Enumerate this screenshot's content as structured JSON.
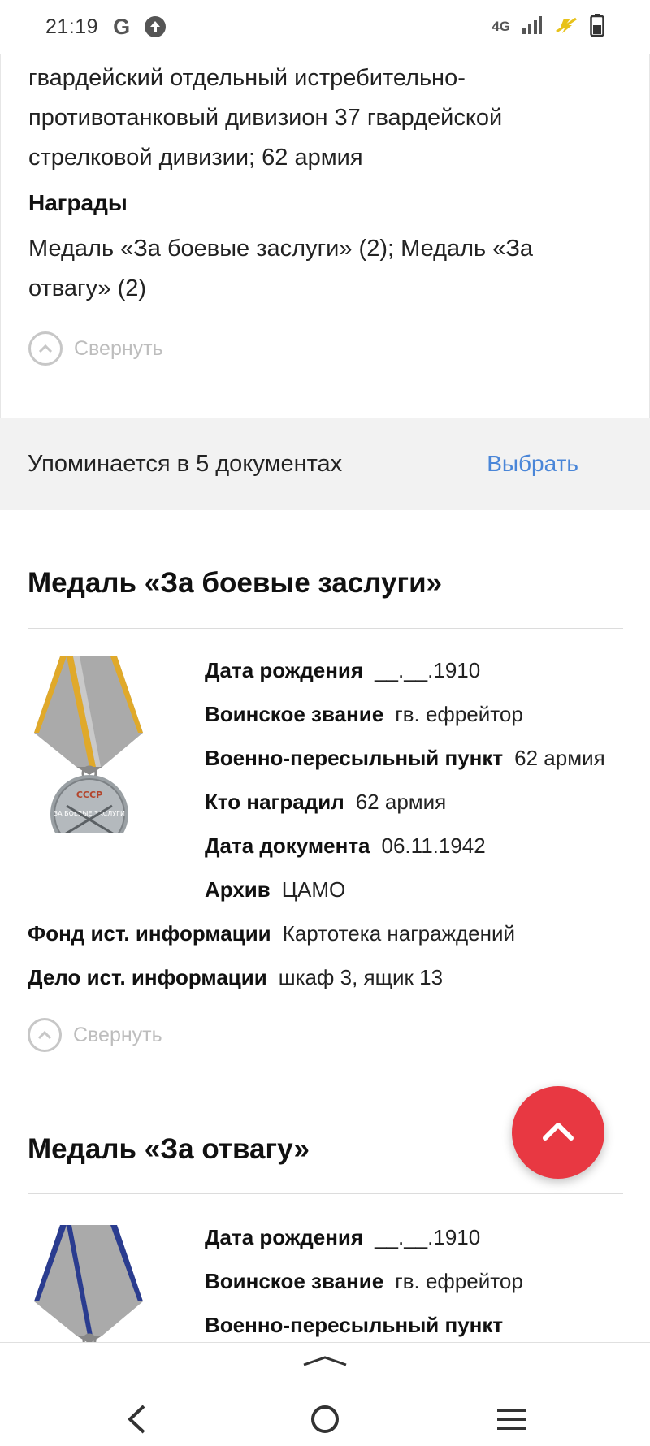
{
  "status_bar": {
    "time": "21:19",
    "network": "4G",
    "icons": [
      "google-icon",
      "upload-icon",
      "signal-icon",
      "power-saving-icon",
      "battery-icon"
    ]
  },
  "soldier_card": {
    "unit_text": "гвардейский отдельный истребительно-противотанковый дивизион 37 гвардейской стрелковой дивизии; 62 армия",
    "awards_heading": "Награды",
    "awards_text": "Медаль «За боевые заслуги» (2); Медаль «За отвагу» (2)",
    "collapse_label": "Свернуть"
  },
  "mentions": {
    "text": "Упоминается в 5 документах",
    "select_label": "Выбрать"
  },
  "award1": {
    "title": "Медаль «За боевые заслуги»",
    "medal_lettering": [
      "СССР",
      "ЗА БОЕВЫЕ ЗАСЛУГИ"
    ],
    "fields": [
      {
        "label": "Дата рождения",
        "value": "__.__.1910"
      },
      {
        "label": "Воинское звание",
        "value": "гв. ефрейтор"
      },
      {
        "label": "Военно-пересыльный пункт",
        "value": "62 армия"
      },
      {
        "label": "Кто наградил",
        "value": "62 армия"
      },
      {
        "label": "Дата документа",
        "value": "06.11.1942"
      },
      {
        "label": "Архив",
        "value": "ЦАМО"
      },
      {
        "label": "Фонд ист. информации",
        "value": "Картотека награждений"
      },
      {
        "label": "Дело ист. информации",
        "value": "шкаф 3, ящик 13"
      }
    ],
    "collapse_label": "Свернуть"
  },
  "award2": {
    "title": "Медаль «За отвагу»",
    "fields": [
      {
        "label": "Дата рождения",
        "value": "__.__.1910"
      },
      {
        "label": "Воинское звание",
        "value": "гв. ефрейтор"
      },
      {
        "label": "Военно-пересыльный пункт",
        "value": ""
      }
    ]
  },
  "colors": {
    "accent_link": "#4a86d8",
    "fab": "#e83842",
    "band": "#f2f2f2",
    "ribbon_stripe_award1": "#e0a92a",
    "ribbon_stripe_award2": "#2a3c8f"
  }
}
